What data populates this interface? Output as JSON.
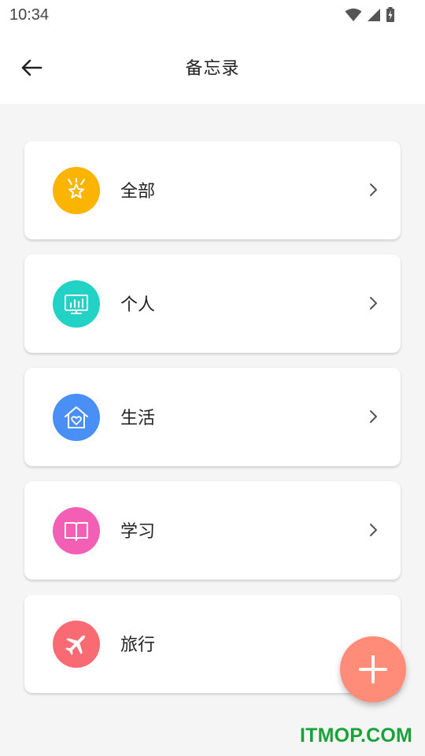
{
  "status_bar": {
    "time": "10:34"
  },
  "header": {
    "title": "备忘录"
  },
  "categories": [
    {
      "label": "全部",
      "icon": "award-star-icon",
      "color": "#fbb400"
    },
    {
      "label": "个人",
      "icon": "monitor-chart-icon",
      "color": "#22d3c5"
    },
    {
      "label": "生活",
      "icon": "home-heart-icon",
      "color": "#4a8ff5"
    },
    {
      "label": "学习",
      "icon": "book-icon",
      "color": "#f25fb4"
    },
    {
      "label": "旅行",
      "icon": "airplane-icon",
      "color": "#fa6a72"
    }
  ],
  "fab": {
    "icon": "plus-icon",
    "color": "#ff8c78"
  },
  "watermark": "ITMOP.COM"
}
